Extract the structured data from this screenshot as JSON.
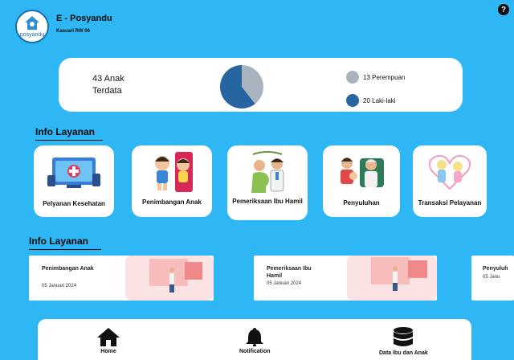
{
  "header": {
    "logo_text": "posyandu",
    "title": "E - Posyandu",
    "subtitle": "Kasuari RW 06",
    "help_label": "?"
  },
  "summary": {
    "count_text": "43 Anak Terdata",
    "legend": [
      {
        "label": "13 Perempuan",
        "color": "#a9b3bd",
        "value": 13
      },
      {
        "label": "20 Laki-laki",
        "color": "#2665a0",
        "value": 20
      }
    ]
  },
  "services_section": {
    "title": "Info Layanan",
    "items": [
      {
        "label": "Pelyanan Kesehatan",
        "icon": "health-service-icon"
      },
      {
        "label": "Penimbangan Anak",
        "icon": "children-icon"
      },
      {
        "label": "Pemeriksaan Ibu Hamil",
        "icon": "pregnancy-check-icon"
      },
      {
        "label": "Penyuluhan",
        "icon": "counseling-icon"
      },
      {
        "label": "Transaksi Pelayanan",
        "icon": "transaction-icon"
      }
    ]
  },
  "schedule_section": {
    "title": "Info Layanan",
    "items": [
      {
        "title": "Penimbangan Anak",
        "date": "05 Januari 2024"
      },
      {
        "title": "Pemeriksaan Ibu Hamil",
        "date": "05 Januari 2024"
      },
      {
        "title": "Penyuluh",
        "date": "05 Janu"
      }
    ]
  },
  "bottom_nav": {
    "items": [
      {
        "label": "Home",
        "icon": "home-icon"
      },
      {
        "label": "Notification",
        "icon": "bell-icon"
      },
      {
        "label": "Data Ibu dan Anak",
        "icon": "database-icon"
      }
    ]
  }
}
